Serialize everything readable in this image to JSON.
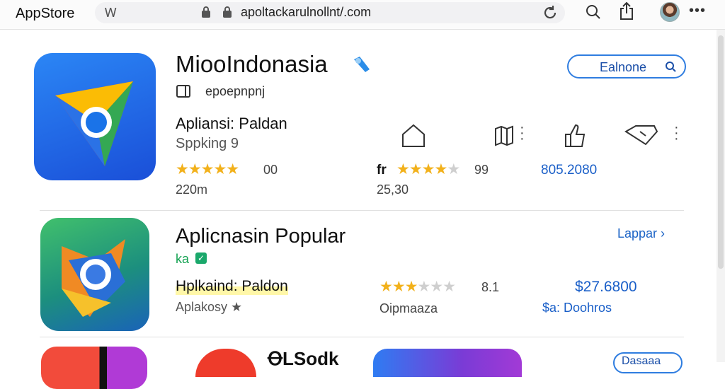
{
  "window": {
    "app_title": "AppStore",
    "url_prefix_icon": "Ꮃ",
    "url": "apoltackarulnollnt/.com"
  },
  "toolbar": {
    "search_icon": "search-icon",
    "share_icon": "share-icon",
    "more_label": "•••"
  },
  "featured": {
    "title": "MiooIndonasia",
    "developer": "epoepnpnj",
    "category": "Apliansi: Paldan",
    "subtitle": "Sppking 9",
    "rating_label": "00",
    "size": "220m",
    "stars_filled": 5,
    "button_label": "Ealnone",
    "label2": "fr",
    "rating2": "99",
    "stars2_filled": 4,
    "count2": "25,30",
    "price": "805.2080"
  },
  "popular": {
    "title": "Aplicnasin Popular",
    "tag": "ka",
    "category": "Hplkaind: Paldon",
    "subtitle": "Aplakosy ★",
    "stars_filled": 3,
    "rating": "8.1",
    "count": "Oipmaaza",
    "price": "$27.6800",
    "price_sub": "$a: Doohros",
    "button_label": "Lappar ›"
  },
  "row3": {
    "logo_text": "ꝊLSodk",
    "button_label": "Dasaaa"
  },
  "colors": {
    "accent": "#2f7de0",
    "star": "#f2b11b",
    "price": "#1a5fc8"
  }
}
